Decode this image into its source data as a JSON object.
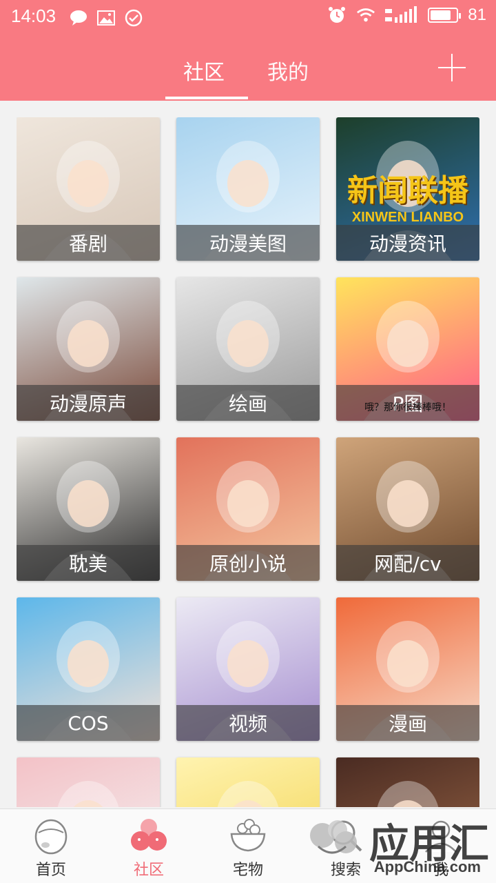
{
  "status_bar": {
    "time": "14:03",
    "battery": "81",
    "battery_level": 0.81
  },
  "tabs": [
    {
      "label": "社区",
      "active": true
    },
    {
      "label": "我的",
      "active": false
    }
  ],
  "grid": {
    "items": [
      {
        "label": "番剧",
        "art": "bride-icon",
        "colors": [
          "#efe6dc",
          "#d7c7b8"
        ]
      },
      {
        "label": "动漫美图",
        "art": "sailor-girl-icon",
        "colors": [
          "#a8d3ef",
          "#e7f3fb"
        ]
      },
      {
        "label": "动漫资讯",
        "art": "news-globe-icon",
        "colors": [
          "#1d3f2a",
          "#2f6fb0"
        ],
        "overlay_title": "新闻联播",
        "overlay_sub": "XINWEN LIANBO"
      },
      {
        "label": "动漫原声",
        "art": "headphones-girl-icon",
        "colors": [
          "#dfe7ea",
          "#7b4a3a"
        ]
      },
      {
        "label": "绘画",
        "art": "sketch-icon",
        "colors": [
          "#e6e6e6",
          "#9b9b9b"
        ]
      },
      {
        "label": "P图",
        "art": "rainbow-meme-icon",
        "colors": [
          "#ffe45c",
          "#ff5a8a"
        ],
        "overlay_caption": "哦？那你很棒棒哦！"
      },
      {
        "label": "耽美",
        "art": "two-boys-icon",
        "colors": [
          "#e9e6e0",
          "#2a2a2a"
        ]
      },
      {
        "label": "原创小说",
        "art": "glasses-girl-icon",
        "colors": [
          "#e2725b",
          "#f4c6a0"
        ]
      },
      {
        "label": "网配/cv",
        "art": "microphone-girl-icon",
        "colors": [
          "#cfa47a",
          "#6e4a2e"
        ]
      },
      {
        "label": "COS",
        "art": "blue-hair-icon",
        "colors": [
          "#5db7ea",
          "#f2e1d7"
        ]
      },
      {
        "label": "视频",
        "art": "lavender-girl-icon",
        "colors": [
          "#eceaf4",
          "#a68fd0"
        ]
      },
      {
        "label": "漫画",
        "art": "orange-hair-icon",
        "colors": [
          "#f06a3a",
          "#f7d9c7"
        ]
      },
      {
        "label": "",
        "art": "manga-page-icon",
        "colors": [
          "#f3c2c7",
          "#f4f4f4"
        ]
      },
      {
        "label": "",
        "art": "blonde-girl-icon",
        "colors": [
          "#fff3b0",
          "#f1d14a"
        ]
      },
      {
        "label": "",
        "art": "library-girl-icon",
        "colors": [
          "#4a2b22",
          "#a06a48"
        ]
      }
    ]
  },
  "bottom_nav": [
    {
      "label": "首页",
      "icon": "egg-icon",
      "active": false
    },
    {
      "label": "社区",
      "icon": "community-bubbles-icon",
      "active": true
    },
    {
      "label": "宅物",
      "icon": "bowl-icon",
      "active": false
    },
    {
      "label": "搜索",
      "icon": "search-icon",
      "active": false
    },
    {
      "label": "我",
      "icon": "profile-icon",
      "active": false
    }
  ],
  "watermark": {
    "text": "应用汇",
    "sub": "AppChina.com",
    "badge": "2"
  },
  "colors": {
    "header": "#f97a82",
    "active_nav": "#f06b76"
  }
}
